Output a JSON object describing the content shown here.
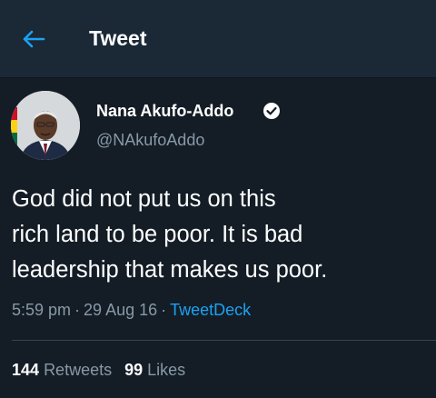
{
  "header": {
    "title": "Tweet",
    "back_icon": "back-arrow-icon",
    "accent": "#1da1f2"
  },
  "author": {
    "name": "Nana Akufo-Addo",
    "handle": "@NAkufoAddo",
    "verified": true,
    "verified_icon": "verified-badge-icon"
  },
  "tweet": {
    "lines": [
      "God did not put us on this",
      "rich land to be poor. It is bad",
      "leadership that makes us poor."
    ],
    "time": "5:59 pm",
    "date": "29 Aug 16",
    "separator": "·",
    "source": "TweetDeck"
  },
  "stats": {
    "retweets_count": "144",
    "retweets_label": "Retweets",
    "likes_count": "99",
    "likes_label": "Likes"
  }
}
